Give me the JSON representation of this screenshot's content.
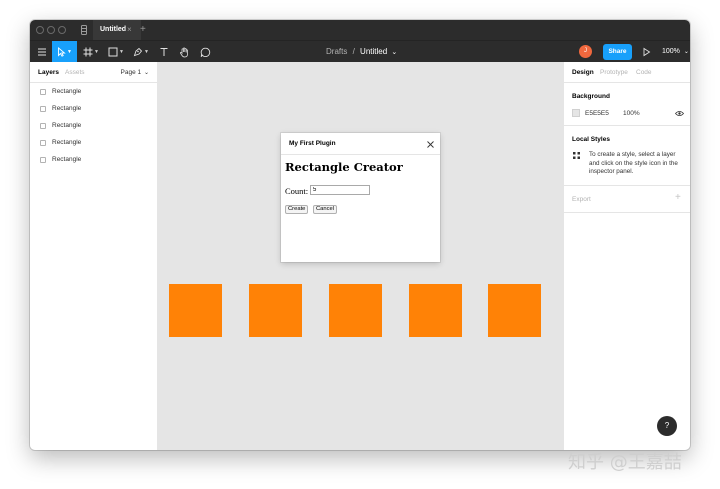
{
  "tab": {
    "title": "Untitled",
    "close": "×",
    "add": "+"
  },
  "toolbar": {
    "breadcrumb_parent": "Drafts",
    "breadcrumb_sep": "/",
    "breadcrumb_current": "Untitled",
    "breadcrumb_chevron": "⌄",
    "avatar_initial": "J",
    "share_label": "Share",
    "zoom": "100%",
    "zoom_chevron": "⌄",
    "tools": [
      "menu-icon",
      "move-icon",
      "frame-icon",
      "shape-icon",
      "pen-icon",
      "text-icon",
      "hand-icon",
      "comment-icon"
    ],
    "active_color": "#18a0fb"
  },
  "left_panel": {
    "tab_layers": "Layers",
    "tab_assets": "Assets",
    "page": "Page 1",
    "page_chevron": "⌄",
    "layers": [
      "Rectangle",
      "Rectangle",
      "Rectangle",
      "Rectangle",
      "Rectangle"
    ]
  },
  "plugin": {
    "window_title": "My First Plugin",
    "heading": "Rectangle Creator",
    "count_label": "Count:",
    "count_value": "5",
    "create_label": "Create",
    "cancel_label": "Cancel"
  },
  "canvas": {
    "background": "#e5e5e5",
    "rect_color": "#ff8206",
    "rect_count": 5
  },
  "right_panel": {
    "tab_design": "Design",
    "tab_prototype": "Prototype",
    "tab_code": "Code",
    "background_title": "Background",
    "background_hex": "E5E5E5",
    "background_opacity": "100%",
    "local_styles_title": "Local Styles",
    "local_styles_desc": "To create a style, select a layer and click on the style icon in the inspector panel.",
    "export_title": "Export",
    "export_add": "+"
  },
  "help": {
    "label": "?"
  },
  "watermark": "知乎 @王嘉喆"
}
